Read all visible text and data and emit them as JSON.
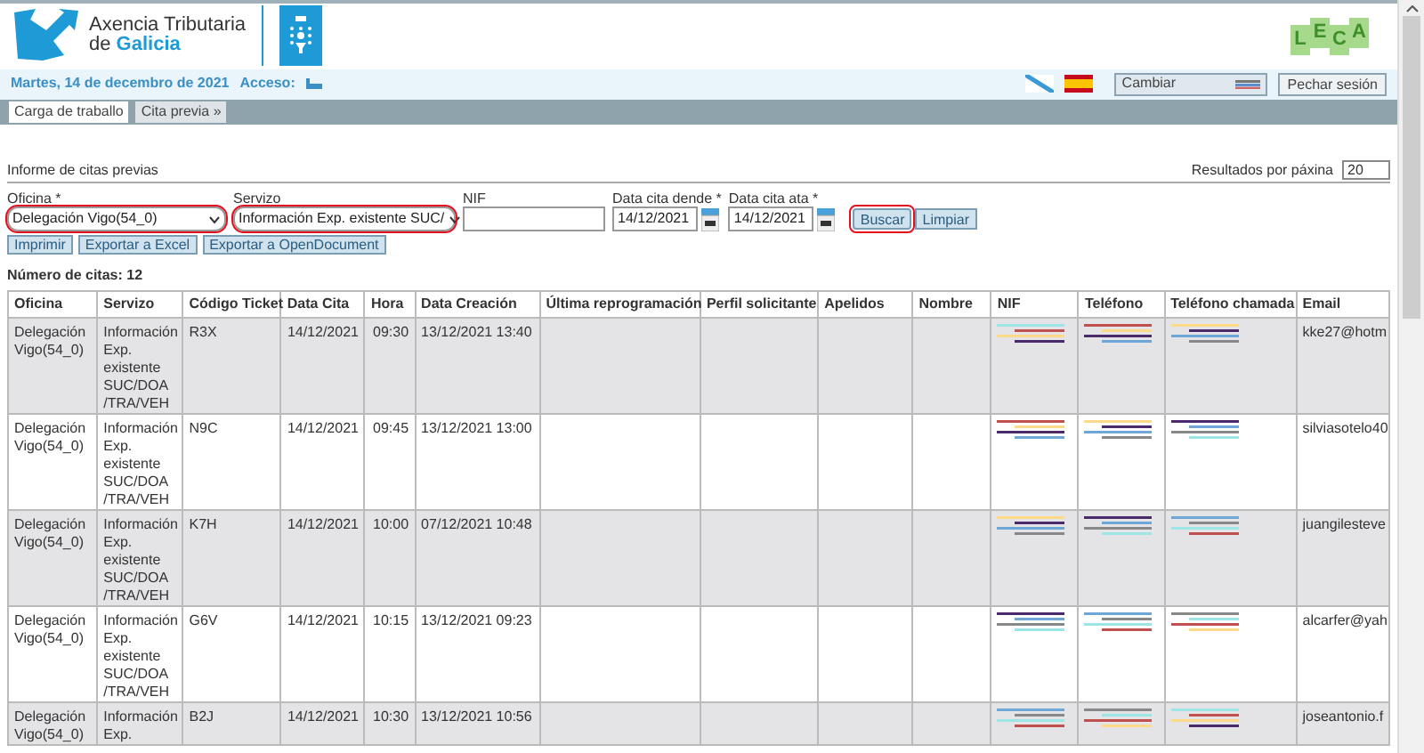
{
  "header": {
    "brand_line1": "Axencia Tributaria",
    "brand_line2_prefix": "de",
    "brand_line2_highlight": "Galicia",
    "app_logo": [
      "L",
      "E",
      "C",
      "A"
    ]
  },
  "info_bar": {
    "date": "Martes, 14 de decembro de 2021",
    "access_label": "Acceso:",
    "change_button": "Cambiar",
    "logout_button": "Pechar sesión"
  },
  "tabs": [
    {
      "label": "Carga de traballo",
      "selected": true
    },
    {
      "label": "Cita previa »",
      "selected": false
    }
  ],
  "report": {
    "title": "Informe de citas previas",
    "page_size_label": "Resultados por páxina",
    "page_size": "20"
  },
  "filters": [
    {
      "kind": "select",
      "label": "Oficina *",
      "value": "Delegación Vigo(54_0)",
      "highlighted": true
    },
    {
      "kind": "select",
      "label": "Servizo",
      "value": "Información Exp. existente SUC/",
      "highlighted": true
    },
    {
      "kind": "text",
      "label": "NIF",
      "highlighted": false
    },
    {
      "kind": "date",
      "label": "Data cita dende *",
      "value": "14/12/2021",
      "highlighted": false
    },
    {
      "kind": "date",
      "label": "Data cita ata *",
      "value": "14/12/2021",
      "highlighted": false
    }
  ],
  "search_buttons": [
    {
      "label": "Buscar",
      "highlighted": true
    },
    {
      "label": "Limpiar",
      "highlighted": false
    }
  ],
  "export_buttons": [
    "Imprimir",
    "Exportar a Excel",
    "Exportar a OpenDocument"
  ],
  "count_label": "Número de citas: 12",
  "table": {
    "columns": [
      "Oficina",
      "Servizo",
      "Código Ticket",
      "Data Cita",
      "Hora",
      "Data Creación",
      "Última reprogramación",
      "Perfil solicitante",
      "Apelidos",
      "Nombre",
      "NIF",
      "Teléfono",
      "Teléfono chamada",
      "Email"
    ],
    "rows": [
      [
        "Delegación Vigo(54_0)",
        "Información Exp. existente SUC/DOA /TRA/VEH",
        "R3X",
        "14/12/2021",
        "09:30",
        "13/12/2021 13:40",
        "",
        "",
        "",
        "",
        "",
        "",
        "",
        "kke27@hotm"
      ],
      [
        "Delegación Vigo(54_0)",
        "Información Exp. existente SUC/DOA /TRA/VEH",
        "N9C",
        "14/12/2021",
        "09:45",
        "13/12/2021 13:00",
        "",
        "",
        "",
        "",
        "",
        "",
        "",
        "silviasotelo40"
      ],
      [
        "Delegación Vigo(54_0)",
        "Información Exp. existente SUC/DOA /TRA/VEH",
        "K7H",
        "14/12/2021",
        "10:00",
        "07/12/2021 10:48",
        "",
        "",
        "",
        "",
        "",
        "",
        "",
        "juangilesteve"
      ],
      [
        "Delegación Vigo(54_0)",
        "Información Exp. existente SUC/DOA /TRA/VEH",
        "G6V",
        "14/12/2021",
        "10:15",
        "13/12/2021 09:23",
        "",
        "",
        "",
        "",
        "",
        "",
        "",
        "alcarfer@yah"
      ],
      [
        "Delegación Vigo(54_0)",
        "Información Exp.",
        "B2J",
        "14/12/2021",
        "10:30",
        "13/12/2021 10:56",
        "",
        "",
        "",
        "",
        "",
        "",
        "",
        "joseantonio.f"
      ]
    ]
  }
}
